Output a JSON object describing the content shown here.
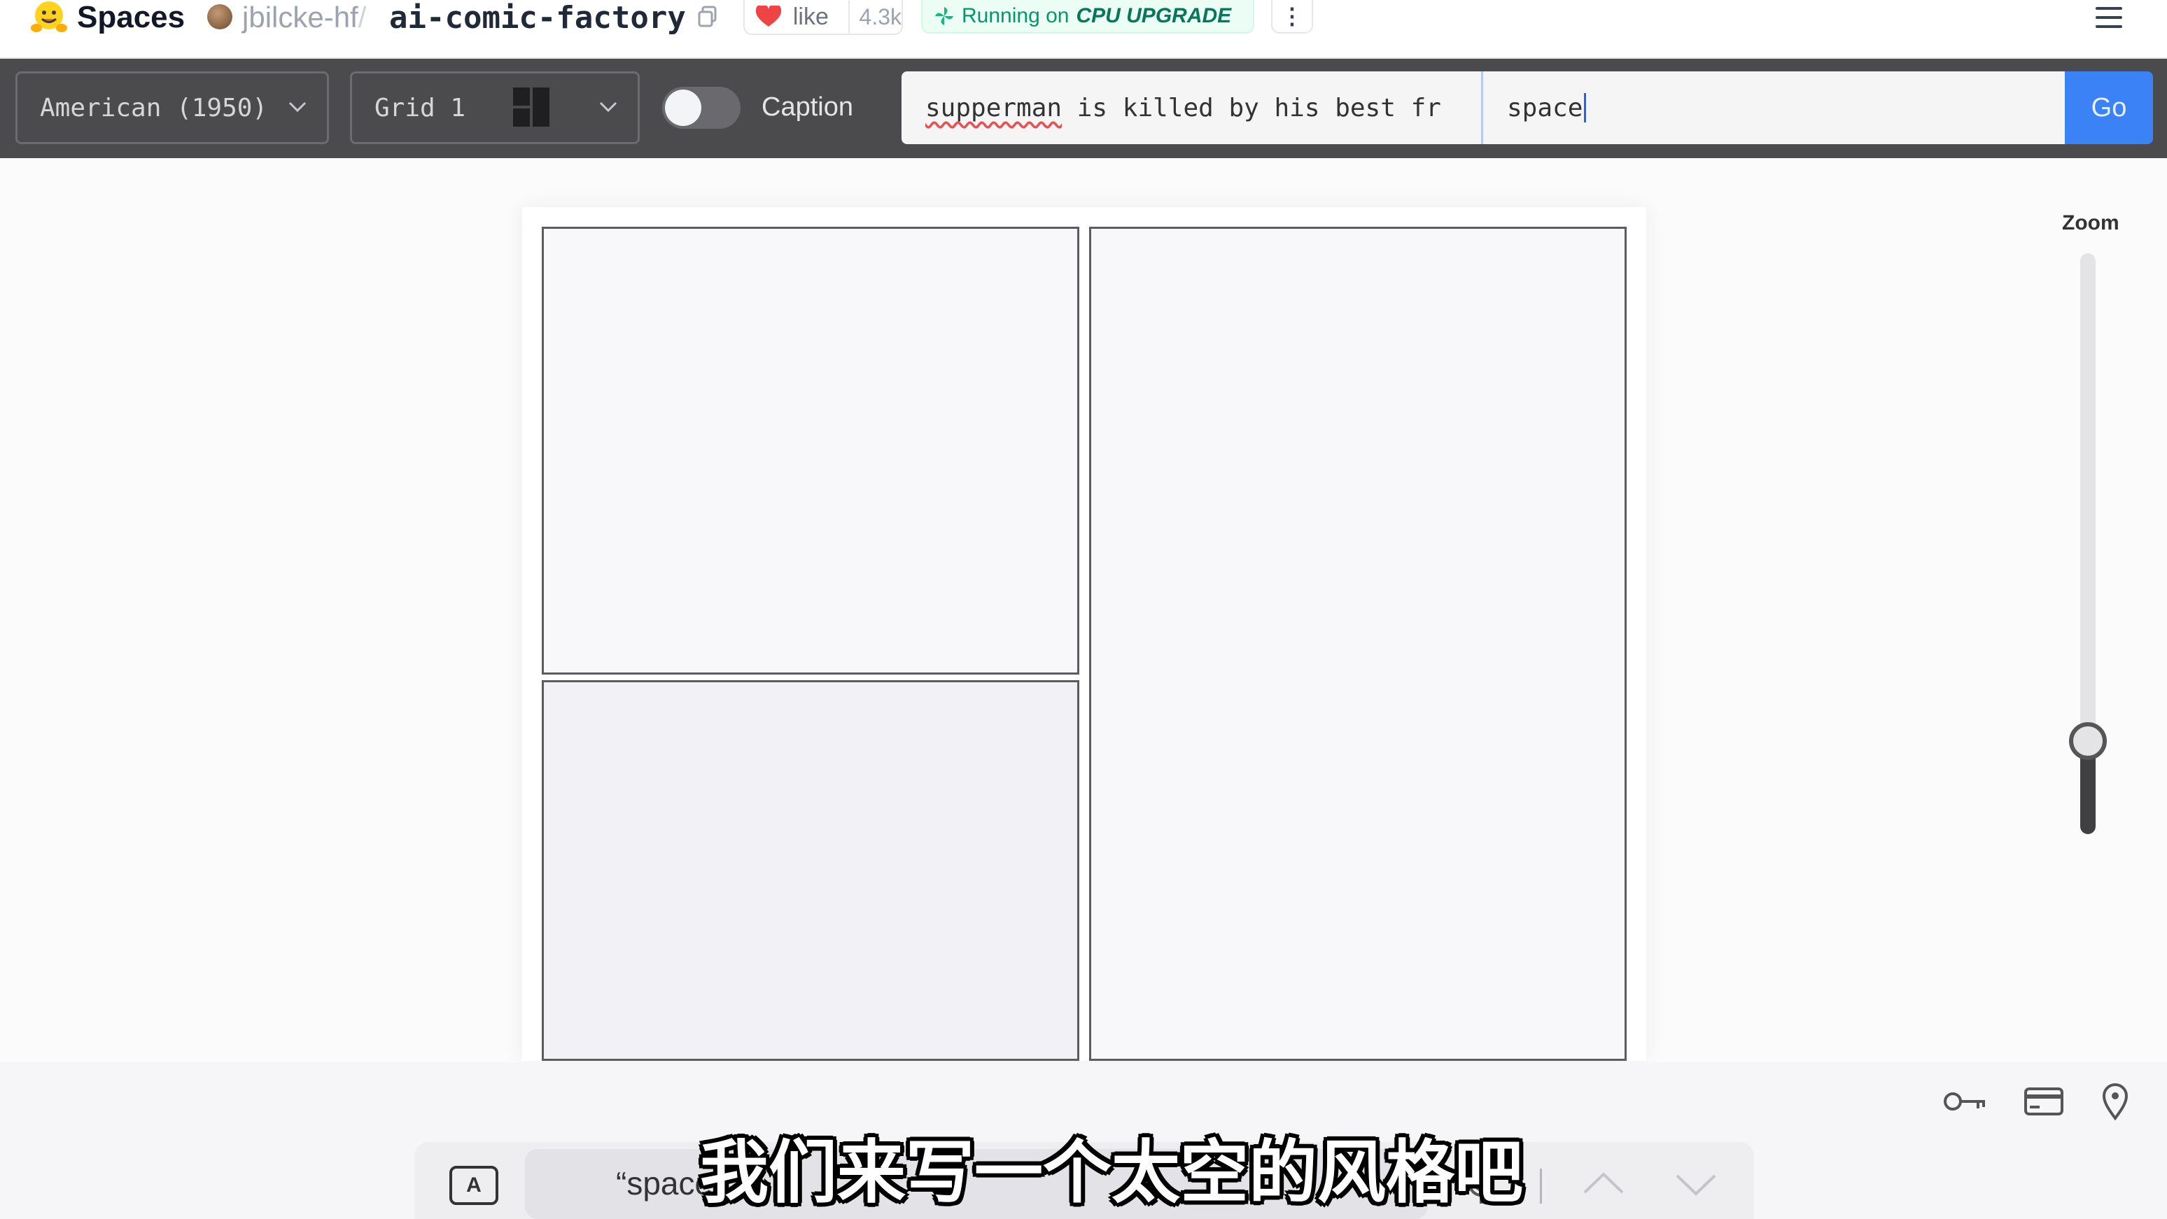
{
  "header": {
    "spaces_label": "Spaces",
    "owner": "jbilcke-hf",
    "separator": "/",
    "repo": "ai-comic-factory",
    "like_label": "like",
    "like_count": "4.3k",
    "status_prefix": "Running on",
    "status_hardware": "CPU UPGRADE",
    "more_label": "⋮"
  },
  "toolbar": {
    "style_value": "American (1950)",
    "layout_value": "Grid 1",
    "caption_label": "Caption",
    "caption_enabled": false,
    "prompt_misspelled": "supperman",
    "prompt_rest": " is killed by his best fr",
    "style_input_value": "space",
    "go_label": "Go"
  },
  "zoom": {
    "label": "Zoom",
    "level_fraction": 0.17
  },
  "keyboard": {
    "a_key_label": "A",
    "suggestion": "“space"
  },
  "subtitle": "我们来写一个太空的风格吧",
  "colors": {
    "toolbar_bg": "#4b4b4e",
    "go_button": "#3b82f6",
    "running_text": "#059669"
  }
}
